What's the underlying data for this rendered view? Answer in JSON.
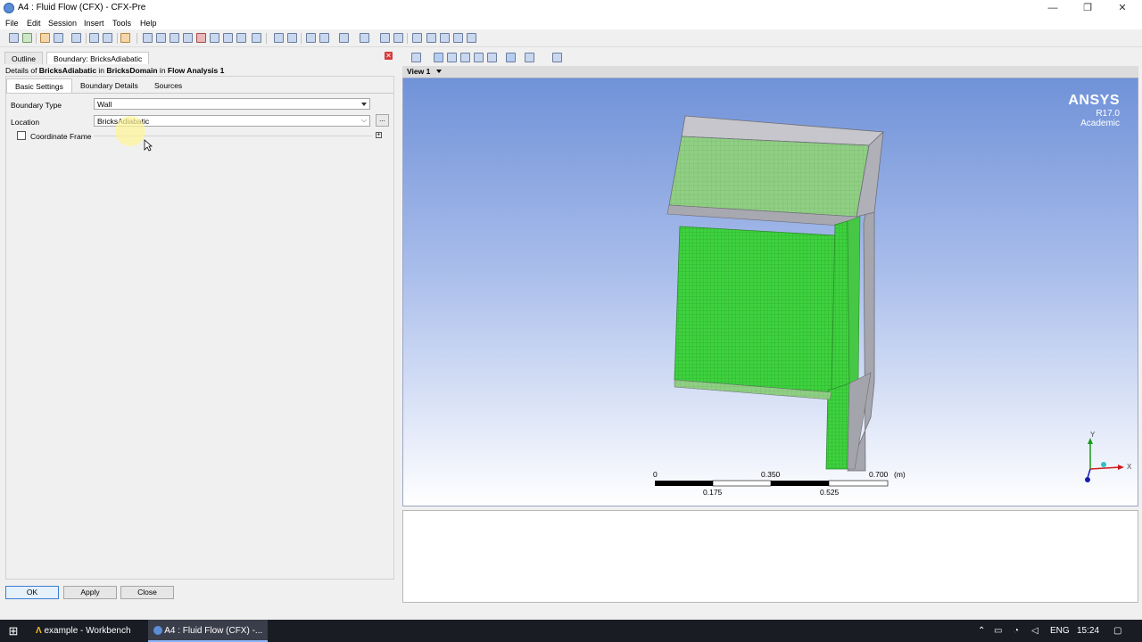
{
  "window": {
    "title": "A4 : Fluid Flow (CFX) - CFX-Pre",
    "minimize": "—",
    "maximize": "❐",
    "close": "✕"
  },
  "menu": [
    "File",
    "Edit",
    "Session",
    "Insert",
    "Tools",
    "Help"
  ],
  "panel": {
    "tabs": [
      "Outline",
      "Boundary: BricksAdiabatic"
    ],
    "close_icon": "✕",
    "details": {
      "prefix": "Details of ",
      "boundary": "BricksAdiabatic",
      "in1": " in ",
      "domain": "BricksDomain",
      "in2": " in ",
      "analysis": "Flow Analysis 1"
    },
    "subtabs": [
      "Basic Settings",
      "Boundary Details",
      "Sources"
    ],
    "boundary_type_label": "Boundary Type",
    "boundary_type_value": "Wall",
    "location_label": "Location",
    "location_value": "BricksAdiabatic",
    "ellipsis": "...",
    "coordinate_frame_label": "Coordinate Frame",
    "coordinate_frame_checked": false,
    "buttons": {
      "ok": "OK",
      "apply": "Apply",
      "close": "Close"
    }
  },
  "viewer": {
    "view_label": "View 1",
    "brand": "ANSYS",
    "version": "R17.0",
    "edition": "Academic",
    "scale": {
      "top": [
        "0",
        "0.350",
        "0.700",
        "(m)"
      ],
      "bottom": [
        "0.175",
        "0.525"
      ]
    },
    "axes": {
      "y": "Y",
      "x": "X"
    }
  },
  "taskbar": {
    "items": [
      "example - Workbench",
      "A4 : Fluid Flow (CFX) -..."
    ],
    "lang": "ENG",
    "time": "15:24"
  },
  "colors": {
    "mesh_green": "#3ed23e",
    "body_grey": "#a0a0a8",
    "viewport_top": "#7092d8"
  }
}
